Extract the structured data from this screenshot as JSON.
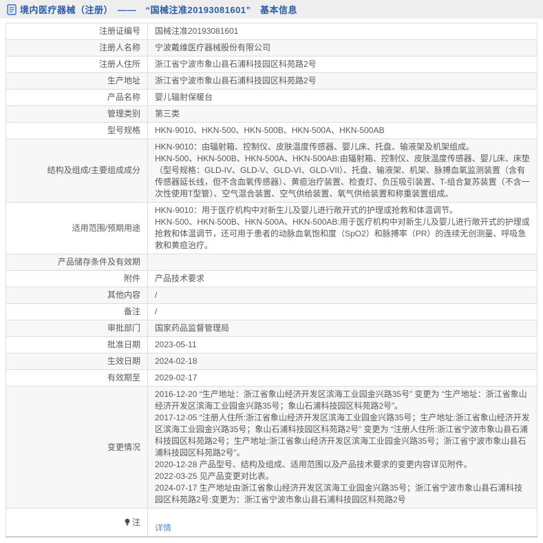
{
  "header": {
    "title": "境内医疗器械（注册）　——　“国械注准20193081601”　基本信息",
    "icon": "document-icon"
  },
  "colors": {
    "header_bg": "#eeeeee",
    "title_blue": "#2a5caa",
    "link_blue": "#4b91dc",
    "row_stripe": "#f7f7f7",
    "border": "#dddddd",
    "text": "#595959"
  },
  "table": {
    "rows": [
      {
        "label": "注册证编号",
        "value": "国械注准20193081601"
      },
      {
        "label": "注册人名称",
        "value": "宁波戴维医疗器械股份有限公司"
      },
      {
        "label": "注册人住所",
        "value": "浙江省宁波市象山县石浦科技园区科苑路2号"
      },
      {
        "label": "生产地址",
        "value": "浙江省宁波市象山县石浦科技园区科苑路2号"
      },
      {
        "label": "产品名称",
        "value": "婴儿辐射保暖台"
      },
      {
        "label": "管理类别",
        "value": "第三类"
      },
      {
        "label": "型号规格",
        "value": "HKN-9010、HKN-500、HKN-500B、HKN-500A、HKN-500AB"
      },
      {
        "label": "结构及组成/主要组成成分",
        "value": "HKN-9010：由辐射箱、控制仪、皮肤温度传感器、婴儿床、托盘、输液架及机架组成。\nHKN-500、HKN-500B、HKN-500A、HKN-500AB:由辐射箱、控制仪、皮肤温度传感器、婴儿床、床垫（型号规格：GLD-IV、GLD-V、GLD-VI、GLD-VII）、托盘、输液架、机架、脉搏血氧监测装置（含有传感器延长线，但不含血氧传感器）、黄疸治疗装置、检查灯、负压吸引装置、T-组合复苏装置（不含一次性使用T型管）、空气混合装置、空气供给装置、氧气供给装置和称重装置组成。"
      },
      {
        "label": "适用范围/预期用途",
        "value": "HKN-9010：用于医疗机构中对新生儿及婴儿进行敞开式的护理或抢救和体温调节。\nHKN-500、HKN-500B、HKN-500A、HKN-500AB:用于医疗机构中对新生儿及婴儿进行敞开式的护理或抢救和体温调节，还可用于患者的动脉血氧饱和度（SpO2）和脉搏率（PR）的连续无创测量、呼吸急救和黄疸治疗。"
      },
      {
        "label": "产品储存条件及有效期",
        "value": ""
      },
      {
        "label": "附件",
        "value": "产品技术要求"
      },
      {
        "label": "其他内容",
        "value": "/"
      },
      {
        "label": "备注",
        "value": "/"
      },
      {
        "label": "审批部门",
        "value": "国家药品监督管理局"
      },
      {
        "label": "批准日期",
        "value": "2023-05-11"
      },
      {
        "label": "生效日期",
        "value": "2024-02-18"
      },
      {
        "label": "有效期至",
        "value": "2029-02-17"
      },
      {
        "label": "变更情况",
        "value": "2016-12-20 “生产地址：浙江省象山经济开发区滨海工业园金兴路35号” 变更为 “生产地址：浙江省象山经济开发区滨海工业园金兴路35号；象山石浦科技园区科苑路2号”。\n2017-12-05 “注册人住所:浙江省象山经济开发区滨海工业园金兴路35号；生产地址:浙江省象山经济开发区滨海工业园金兴路35号；象山石浦科技园区科苑路2号” 变更为 “注册人住所:浙江省宁波市象山县石浦科技园区科苑路2号；生产地址:浙江省象山经济开发区滨海工业园金兴路35号；浙江省宁波市象山县石浦科技园区科苑路2号”。\n2020-12-28 产品型号、结构及组成、适用范围以及产品技术要求的变更内容详见附件。\n2022-03-25 见产品变更对比表。\n2024-07-17 生产地址由浙江省象山经济开发区滨海工业园金兴路35号；浙江省宁波市象山县石浦科技园区科苑路2号:变更为：浙江省宁波市象山县石浦科技园区科苑路2号"
      },
      {
        "label": "注",
        "value": "详情"
      }
    ],
    "note_icon": "lightbulb-icon",
    "details_link_label": "详情"
  }
}
